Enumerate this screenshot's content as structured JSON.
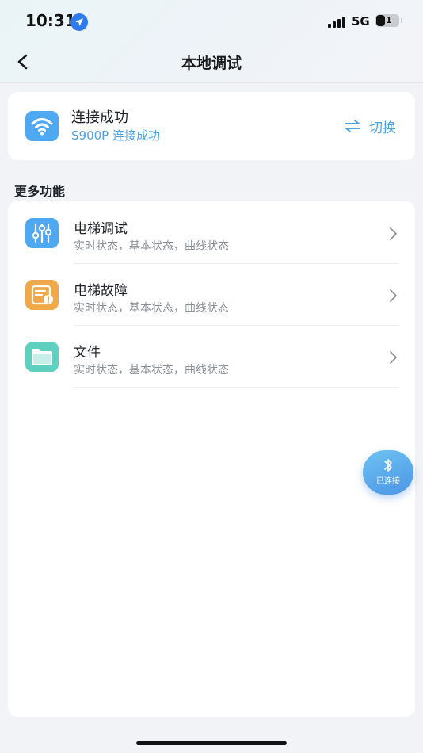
{
  "status_bar": {
    "time": "10:31",
    "network": "5G",
    "battery": "31"
  },
  "nav": {
    "title": "本地调试"
  },
  "connection": {
    "status": "连接成功",
    "device": "S900P 连接成功",
    "switch_label": "切换"
  },
  "section": {
    "title": "更多功能"
  },
  "items": [
    {
      "name": "电梯调试",
      "desc": "实时状态，基本状态，曲线状态",
      "icon": "sliders-icon",
      "color": "#4ea8f2"
    },
    {
      "name": "电梯故障",
      "desc": "实时状态，基本状态，曲线状态",
      "icon": "fault-doc-icon",
      "color": "#f0a94a"
    },
    {
      "name": "文件",
      "desc": "实时状态，基本状态，曲线状态",
      "icon": "folder-icon",
      "color": "#5fcfbf"
    }
  ],
  "bluetooth": {
    "label": "已连接"
  },
  "colors": {
    "accent": "#4da3e6",
    "background": "#f1f3f6",
    "card": "#ffffff"
  }
}
